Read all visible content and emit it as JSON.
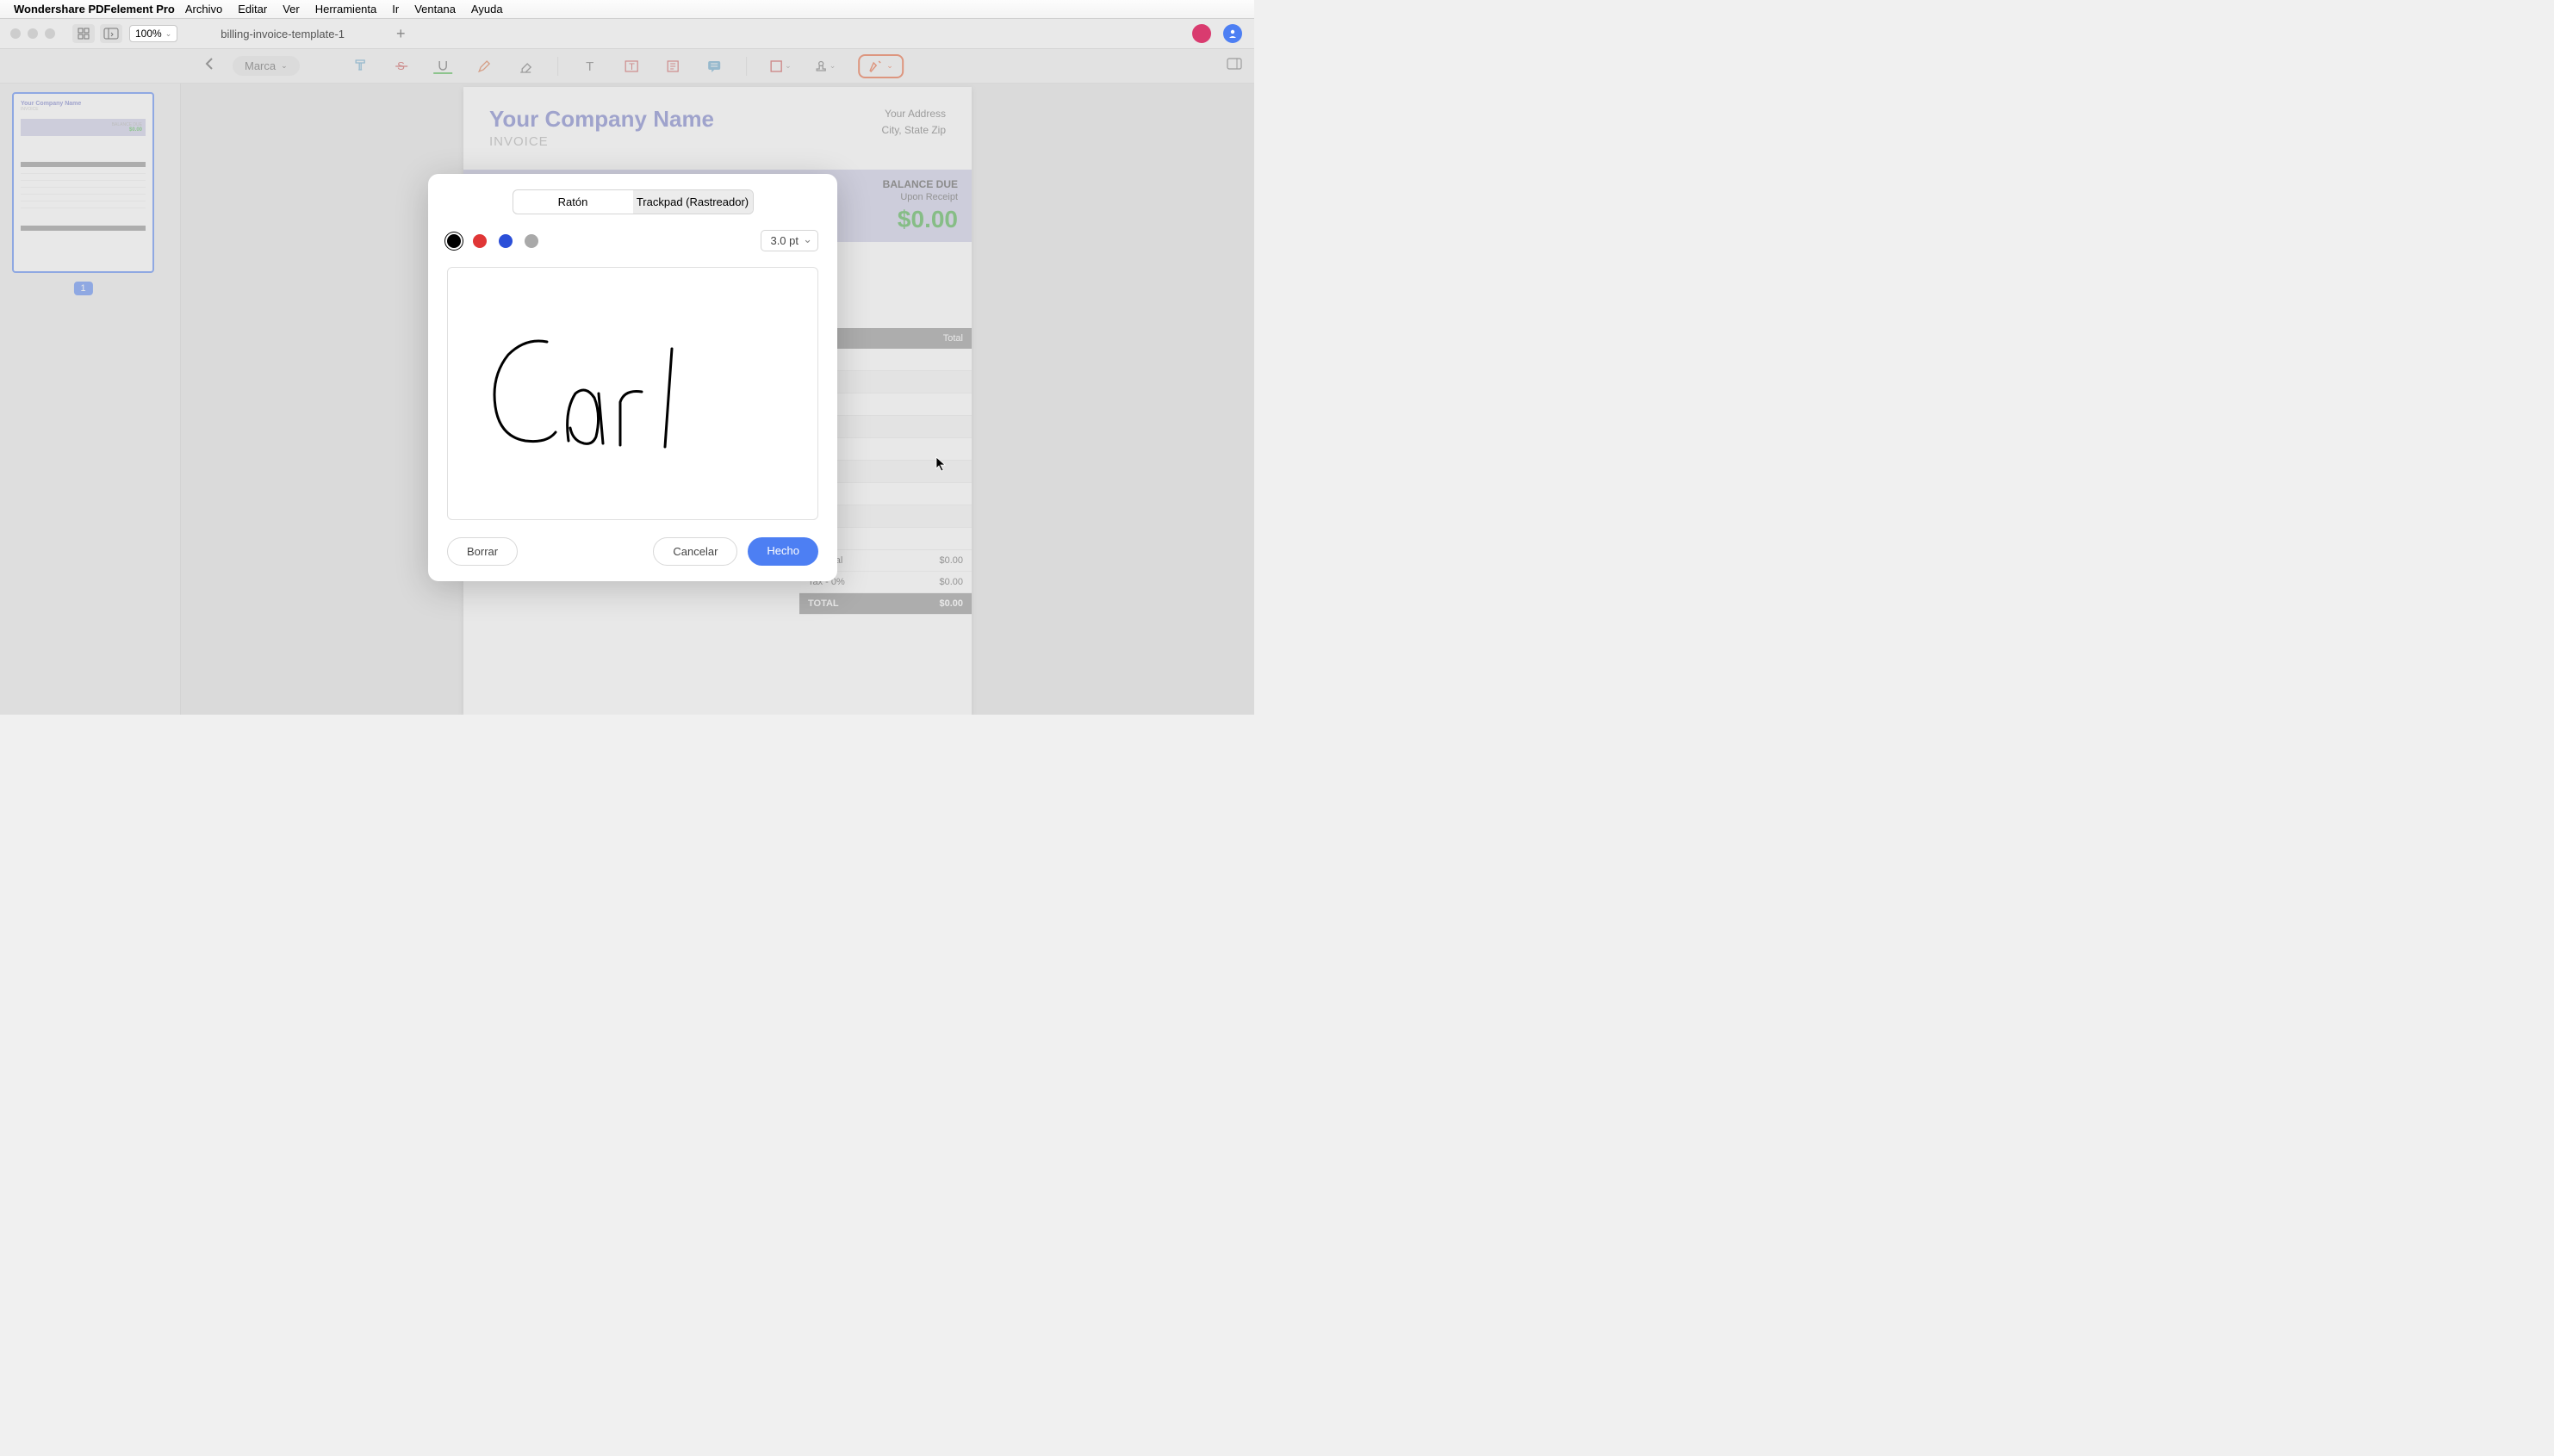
{
  "menubar": {
    "appname": "Wondershare PDFelement Pro",
    "items": [
      "Archivo",
      "Editar",
      "Ver",
      "Herramienta",
      "Ir",
      "Ventana",
      "Ayuda"
    ]
  },
  "window": {
    "zoom": "100%",
    "tab_name": "billing-invoice-template-1"
  },
  "toolbar": {
    "back_nav": "Marca"
  },
  "thumbnail": {
    "page_number": "1",
    "company": "Your Company Name",
    "amount": "$0.00"
  },
  "document": {
    "company_name": "Your Company Name",
    "invoice_label": "INVOICE",
    "address_line1": "Your Address",
    "address_line2": "City, State Zip",
    "balance_due_label": "BALANCE DUE",
    "balance_due_sub": "Upon Receipt",
    "balance_amount": "$0.00",
    "table": {
      "col_total": "Total",
      "subtotal_label": "Subtotal",
      "subtotal_value": "$0.00",
      "tax_label": "Tax - 0%",
      "tax_value": "$0.00",
      "total_label": "TOTAL",
      "total_value": "$0.00"
    }
  },
  "modal": {
    "tab_mouse": "Ratón",
    "tab_trackpad": "Trackpad (Rastreador)",
    "stroke_size": "3.0 pt",
    "colors": {
      "black": "#000000",
      "red": "#e03636",
      "blue": "#2b4fd8",
      "gray": "#a9a9a9"
    },
    "signature_text": "Carl",
    "btn_clear": "Borrar",
    "btn_cancel": "Cancelar",
    "btn_done": "Hecho"
  }
}
